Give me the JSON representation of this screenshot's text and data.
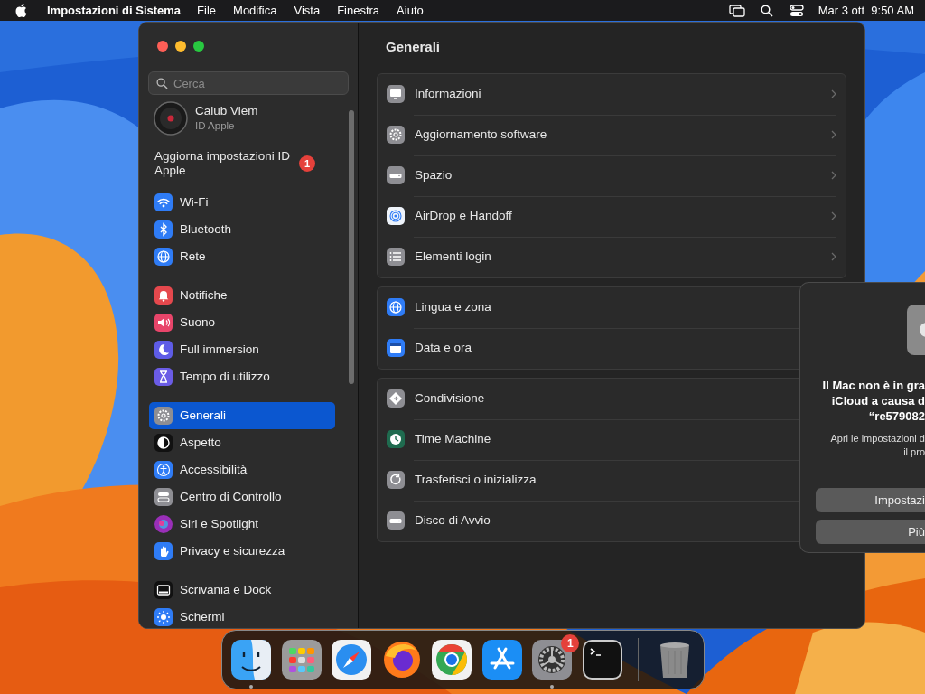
{
  "menubar": {
    "app": "Impostazioni di Sistema",
    "menus": [
      "File",
      "Modifica",
      "Vista",
      "Finestra",
      "Aiuto"
    ],
    "clock": "Mar 3 ott  9:50 AM"
  },
  "window": {
    "search": {
      "placeholder": "Cerca"
    },
    "account": {
      "name": "Calub Viem",
      "subtitle": "ID Apple"
    },
    "notice": {
      "label": "Aggiorna impostazioni ID Apple",
      "badge": "1"
    },
    "sidebar": {
      "groups": [
        [
          {
            "label": "Wi-Fi",
            "kind": "wifi",
            "selected": false
          },
          {
            "label": "Bluetooth",
            "kind": "bluetooth",
            "selected": false
          },
          {
            "label": "Rete",
            "kind": "globe",
            "selected": false
          }
        ],
        [
          {
            "label": "Notifiche",
            "kind": "bell",
            "selected": false
          },
          {
            "label": "Suono",
            "kind": "speaker",
            "selected": false
          },
          {
            "label": "Full immersion",
            "kind": "moon",
            "selected": false
          },
          {
            "label": "Tempo di utilizzo",
            "kind": "hourglass",
            "selected": false
          }
        ],
        [
          {
            "label": "Generali",
            "kind": "gear",
            "selected": true
          },
          {
            "label": "Aspetto",
            "kind": "contrast",
            "selected": false
          },
          {
            "label": "Accessibilità",
            "kind": "person",
            "selected": false
          },
          {
            "label": "Centro di Controllo",
            "kind": "toggles",
            "selected": false
          },
          {
            "label": "Siri e Spotlight",
            "kind": "orb",
            "selected": false
          },
          {
            "label": "Privacy e sicurezza",
            "kind": "hand",
            "selected": false
          }
        ],
        [
          {
            "label": "Scrivania e Dock",
            "kind": "dock",
            "selected": false
          },
          {
            "label": "Schermi",
            "kind": "sun",
            "selected": false
          }
        ]
      ]
    },
    "title": "Generali",
    "sections": [
      [
        {
          "label": "Informazioni",
          "kind": "monitor"
        },
        {
          "label": "Aggiornamento software",
          "kind": "gear"
        },
        {
          "label": "Spazio",
          "kind": "drive"
        },
        {
          "label": "AirDrop e Handoff",
          "kind": "rings"
        },
        {
          "label": "Elementi login",
          "kind": "list"
        }
      ],
      [
        {
          "label": "Lingua e zona",
          "kind": "globe"
        },
        {
          "label": "Data e ora",
          "kind": "calendar"
        }
      ],
      [
        {
          "label": "Condivisione",
          "kind": "diamond"
        },
        {
          "label": "Time Machine",
          "kind": "clock"
        },
        {
          "label": "Trasferisci o inizializza",
          "kind": "reset"
        },
        {
          "label": "Disco di Avvio",
          "kind": "drive"
        }
      ]
    ]
  },
  "dialog": {
    "title_lines": [
      "Il Mac non è in gra",
      "iCloud a causa d",
      "“re579082"
    ],
    "body_lines": [
      "Apri le impostazioni d",
      "il pro"
    ],
    "buttons": [
      "Impostazi",
      "Più"
    ]
  },
  "dock": {
    "items": [
      {
        "kind": "finder",
        "running": true
      },
      {
        "kind": "launchpad",
        "running": false
      },
      {
        "kind": "safari",
        "running": false
      },
      {
        "kind": "firefox",
        "running": false
      },
      {
        "kind": "chrome",
        "running": false
      },
      {
        "kind": "appstore",
        "running": false
      },
      {
        "kind": "settings",
        "running": true,
        "badge": "1"
      },
      {
        "kind": "terminal",
        "running": false
      },
      {
        "kind": "trash",
        "running": false
      }
    ]
  }
}
